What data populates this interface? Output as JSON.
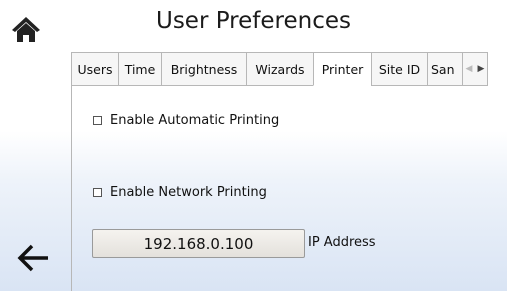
{
  "header": {
    "title": "User Preferences"
  },
  "icons": {
    "home": "home-icon",
    "back": "back-arrow-icon"
  },
  "tabs": [
    {
      "label": "Users",
      "active": false
    },
    {
      "label": "Time",
      "active": false
    },
    {
      "label": "Brightness",
      "active": false
    },
    {
      "label": "Wizards",
      "active": false
    },
    {
      "label": "Printer",
      "active": true
    },
    {
      "label": "Site ID",
      "active": false
    },
    {
      "label": "San",
      "active": false
    }
  ],
  "printer": {
    "auto_print": {
      "label": "Enable Automatic Printing",
      "checked": false
    },
    "network_print": {
      "label": "Enable Network Printing",
      "checked": false
    },
    "ip_address": {
      "value": "192.168.0.100",
      "label": "IP Address"
    }
  },
  "colors": {
    "border": "#b7b7b7",
    "text": "#111111"
  }
}
